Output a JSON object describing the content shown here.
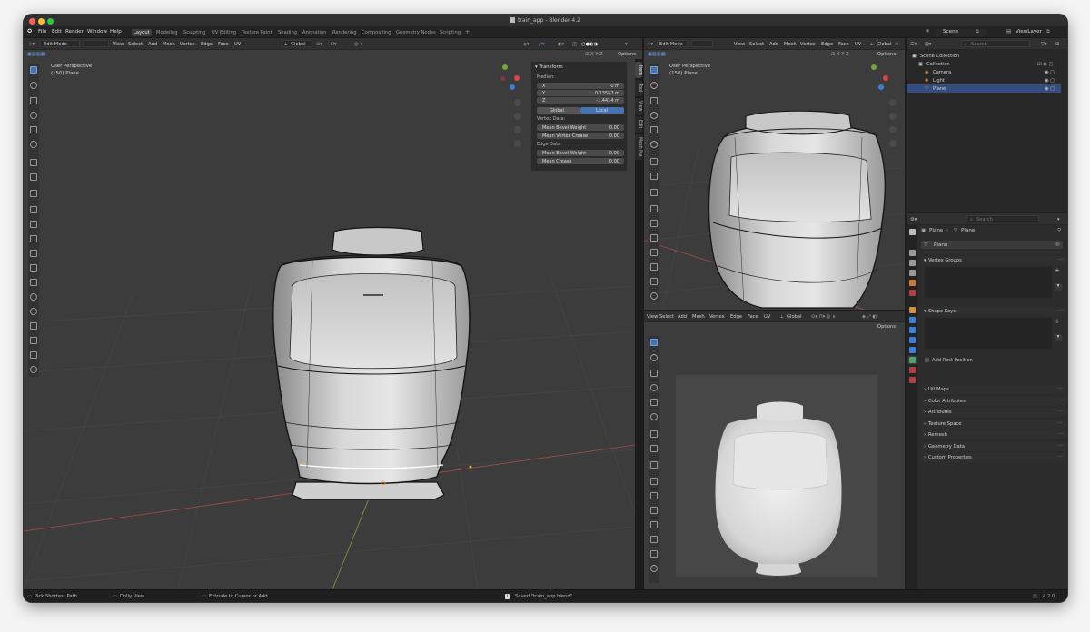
{
  "window": {
    "title": "train_app - Blender 4.2"
  },
  "menu": [
    "File",
    "Edit",
    "Render",
    "Window",
    "Help"
  ],
  "workspaces": [
    "Layout",
    "Modeling",
    "Sculpting",
    "UV Editing",
    "Texture Paint",
    "Shading",
    "Animation",
    "Rendering",
    "Compositing",
    "Geometry Nodes",
    "Scripting"
  ],
  "workspace_add": "+",
  "scene": {
    "label": "Scene",
    "view_layer": "ViewLayer"
  },
  "viewport_main": {
    "mode": "Edit Mode",
    "menus": [
      "View",
      "Select",
      "Add",
      "Mesh",
      "Vertex",
      "Edge",
      "Face",
      "UV"
    ],
    "orientation": "Global",
    "options": "Options",
    "view_name": "User Perspective",
    "object_info": "(150) Plane"
  },
  "npanel": {
    "header": "Transform",
    "median_label": "Median:",
    "rows": [
      {
        "label": "X",
        "value": "0 m"
      },
      {
        "label": "Y",
        "value": "0.13557 m"
      },
      {
        "label": "Z",
        "value": "-1.4414 m"
      }
    ],
    "global_btn": "Global",
    "local_btn": "Local",
    "vertex_data": "Vertex Data:",
    "mean_bevel_weight_v": {
      "label": "Mean Bevel Weight",
      "value": "0.00"
    },
    "mean_vertex_crease": {
      "label": "Mean Vertex Crease",
      "value": "0.00"
    },
    "edge_data": "Edge Data:",
    "mean_bevel_weight_e": {
      "label": "Mean Bevel Weight",
      "value": "0.00"
    },
    "mean_crease": {
      "label": "Mean Crease",
      "value": "0.00"
    },
    "tabs": [
      "Item",
      "Tool",
      "View",
      "Edit",
      "Mesh Ma"
    ]
  },
  "viewport_right": {
    "mode": "Edit Mode",
    "menus": [
      "View",
      "Select",
      "Add",
      "Mesh",
      "Vertex",
      "Edge",
      "Face",
      "UV"
    ],
    "orientation": "Global",
    "options": "Options",
    "view_name": "User Perspective",
    "object_info": "(150) Plane"
  },
  "viewport_bottom": {
    "menus": [
      "View",
      "Select",
      "Add",
      "Mesh",
      "Vertex",
      "Edge",
      "Face",
      "UV"
    ],
    "orientation": "Global",
    "options": "Options"
  },
  "outliner": {
    "search_placeholder": "Search",
    "items": [
      {
        "label": "Scene Collection",
        "depth": 0,
        "icon": "collection-icon",
        "selected": false
      },
      {
        "label": "Collection",
        "depth": 1,
        "icon": "collection-icon",
        "selected": false
      },
      {
        "label": "Camera",
        "depth": 2,
        "icon": "camera-icon",
        "selected": false
      },
      {
        "label": "Light",
        "depth": 2,
        "icon": "light-icon",
        "selected": false
      },
      {
        "label": "Plane",
        "depth": 2,
        "icon": "mesh-icon",
        "selected": true
      }
    ]
  },
  "properties": {
    "search_placeholder": "Search",
    "breadcrumb": [
      "Plane",
      "Plane"
    ],
    "data_name": "Plane",
    "sections": [
      {
        "label": "Vertex Groups",
        "open": true
      },
      {
        "label": "Shape Keys",
        "open": true
      },
      {
        "label": "UV Maps",
        "open": false
      },
      {
        "label": "Color Attributes",
        "open": false
      },
      {
        "label": "Attributes",
        "open": false
      },
      {
        "label": "Texture Space",
        "open": false
      },
      {
        "label": "Remesh",
        "open": false
      },
      {
        "label": "Geometry Data",
        "open": false
      },
      {
        "label": "Custom Properties",
        "open": false
      }
    ],
    "add_rest_position": "Add Rest Position"
  },
  "status": {
    "left": "Pick Shortest Path",
    "mid": "Dolly View",
    "right": "Extrude to Cursor or Add",
    "saved": "Saved \"train_app.blend\"",
    "version": "4.2.0"
  },
  "colors": {
    "accent": "#4772b3",
    "selection": "#334d80",
    "x_axis": "#d8464e",
    "y_axis": "#6ea835",
    "z_axis": "#3c7ed8"
  }
}
